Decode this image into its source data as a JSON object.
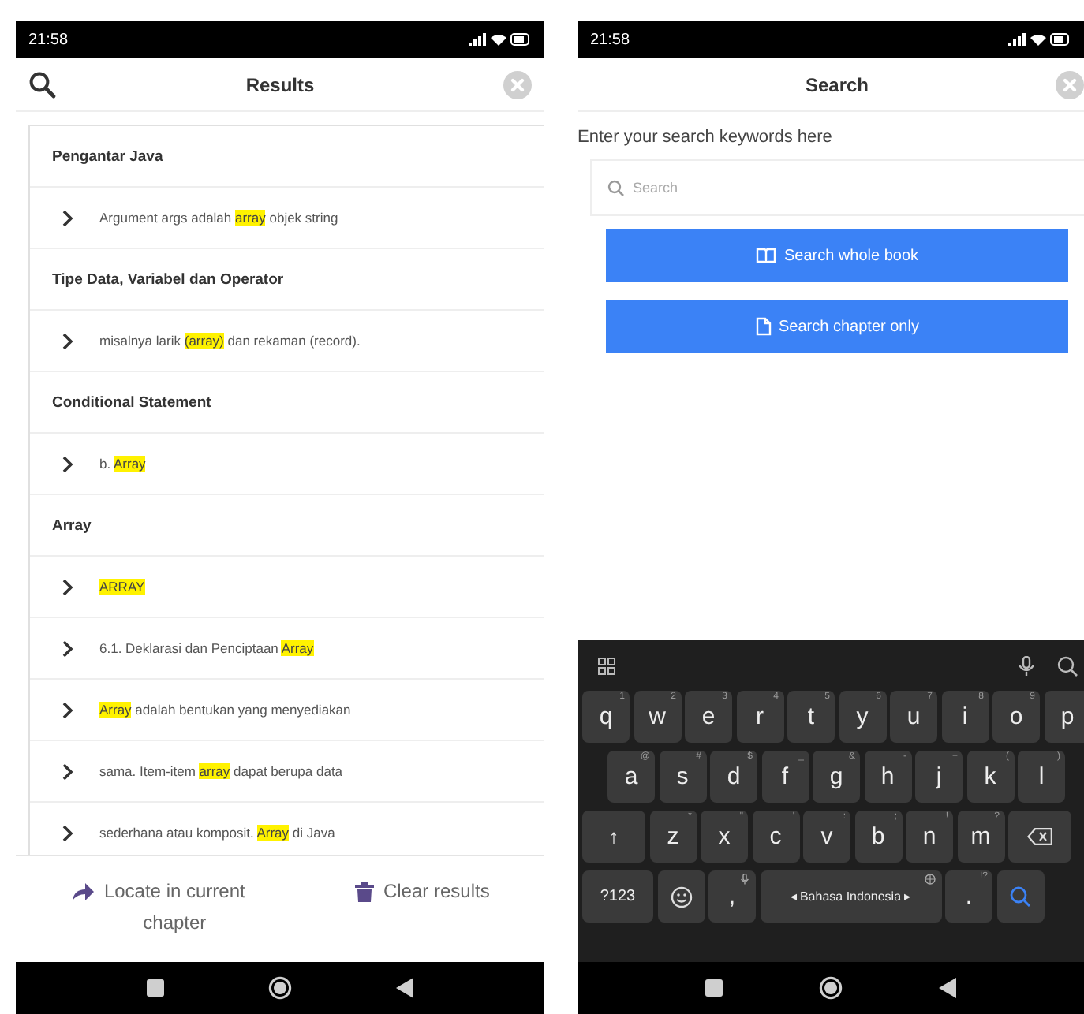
{
  "results_screen": {
    "status_bar": {
      "time": "21:58"
    },
    "title": "Results",
    "groups": [
      {
        "heading": "Pengantar Java",
        "items": [
          {
            "segments": [
              {
                "text": "Argument args adalah ",
                "highlight": false
              },
              {
                "text": "array",
                "highlight": true
              },
              {
                "text": " objek string",
                "highlight": false
              }
            ]
          }
        ]
      },
      {
        "heading": "Tipe Data, Variabel dan Operator",
        "items": [
          {
            "segments": [
              {
                "text": "misalnya larik ",
                "highlight": false
              },
              {
                "text": "(array)",
                "highlight": true
              },
              {
                "text": " dan rekaman (record).",
                "highlight": false
              }
            ]
          }
        ]
      },
      {
        "heading": "Conditional Statement",
        "items": [
          {
            "segments": [
              {
                "text": "b. ",
                "highlight": false
              },
              {
                "text": "Array",
                "highlight": true
              }
            ]
          }
        ]
      },
      {
        "heading": "Array",
        "items": [
          {
            "segments": [
              {
                "text": "ARRAY",
                "highlight": true
              }
            ]
          },
          {
            "segments": [
              {
                "text": "6.1. Deklarasi dan Penciptaan ",
                "highlight": false
              },
              {
                "text": "Array",
                "highlight": true
              }
            ]
          },
          {
            "segments": [
              {
                "text": "Array",
                "highlight": true
              },
              {
                "text": " adalah bentukan yang menyediakan",
                "highlight": false
              }
            ]
          },
          {
            "segments": [
              {
                "text": "sama. Item-item ",
                "highlight": false
              },
              {
                "text": "array",
                "highlight": true
              },
              {
                "text": " dapat berupa data",
                "highlight": false
              }
            ]
          },
          {
            "segments": [
              {
                "text": "sederhana atau komposit. ",
                "highlight": false
              },
              {
                "text": "Array",
                "highlight": true
              },
              {
                "text": " di Java",
                "highlight": false
              }
            ]
          }
        ]
      }
    ],
    "actions": [
      {
        "label": "Locate in current chapter",
        "kind": "locate"
      },
      {
        "label": "Clear results",
        "kind": "clear"
      }
    ]
  },
  "search_screen": {
    "status_bar": {
      "time": "21:58"
    },
    "title": "Search",
    "prompt": "Enter your search keywords here",
    "search": {
      "placeholder": "Search"
    },
    "buttons": [
      {
        "label": "Search whole book",
        "kind": "book"
      },
      {
        "label": "Search chapter only",
        "kind": "chapter"
      }
    ],
    "keyboard": {
      "rows": [
        [
          {
            "kind": "letter",
            "key": "q",
            "hint": "1"
          },
          {
            "kind": "letter",
            "key": "w",
            "hint": "2"
          },
          {
            "kind": "letter",
            "key": "e",
            "hint": "3"
          },
          {
            "kind": "letter",
            "key": "r",
            "hint": "4"
          },
          {
            "kind": "letter",
            "key": "t",
            "hint": "5"
          },
          {
            "kind": "letter",
            "key": "y",
            "hint": "6"
          },
          {
            "kind": "letter",
            "key": "u",
            "hint": "7"
          },
          {
            "kind": "letter",
            "key": "i",
            "hint": "8"
          },
          {
            "kind": "letter",
            "key": "o",
            "hint": "9"
          },
          {
            "kind": "letter",
            "key": "p"
          }
        ],
        [
          {
            "kind": "letter",
            "key": "a",
            "hint": "@"
          },
          {
            "kind": "letter",
            "key": "s",
            "hint": "#"
          },
          {
            "kind": "letter",
            "key": "d",
            "hint": "$"
          },
          {
            "kind": "letter",
            "key": "f",
            "hint": "_"
          },
          {
            "kind": "letter",
            "key": "g",
            "hint": "&"
          },
          {
            "kind": "letter",
            "key": "h",
            "hint": "-"
          },
          {
            "kind": "letter",
            "key": "j",
            "hint": "+"
          },
          {
            "kind": "letter",
            "key": "k",
            "hint": "("
          },
          {
            "kind": "letter",
            "key": "l",
            "hint": ")"
          }
        ],
        [
          {
            "kind": "shift",
            "key": "↑"
          },
          {
            "kind": "letter",
            "key": "z",
            "hint": "*"
          },
          {
            "kind": "letter",
            "key": "x",
            "hint": "\""
          },
          {
            "kind": "letter",
            "key": "c",
            "hint": "'"
          },
          {
            "kind": "letter",
            "key": "v",
            "hint": ":"
          },
          {
            "kind": "letter",
            "key": "b",
            "hint": ";"
          },
          {
            "kind": "letter",
            "key": "n",
            "hint": "!"
          },
          {
            "kind": "letter",
            "key": "m",
            "hint": "?"
          },
          {
            "kind": "backspace"
          }
        ]
      ],
      "bottom_row": [
        {
          "kind": "symbols",
          "key": "?123"
        },
        {
          "kind": "emoji"
        },
        {
          "kind": "comma",
          "key": ","
        },
        {
          "kind": "space",
          "key": "◂ Bahasa Indonesia ▸"
        },
        {
          "kind": "period",
          "key": ".",
          "hint": "!?"
        },
        {
          "kind": "enter"
        }
      ]
    }
  }
}
